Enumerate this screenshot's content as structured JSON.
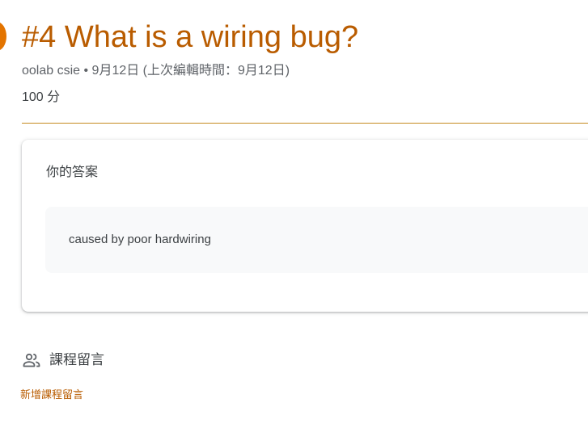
{
  "assignment": {
    "title": "#4 What is a wiring bug?",
    "meta": "oolab csie • 9月12日 (上次編輯時間：9月12日)",
    "points": "100 分"
  },
  "answer_card": {
    "heading": "你的答案",
    "answer_text": "caused by poor hardwiring"
  },
  "comments": {
    "header_icon": "people-icon",
    "label": "課程留言",
    "add_link": "新增課程留言"
  },
  "colors": {
    "accent": "#b95c00",
    "icon_orange": "#e37400",
    "divider": "#c58a1f",
    "answer_bg": "#f8f9fa"
  }
}
